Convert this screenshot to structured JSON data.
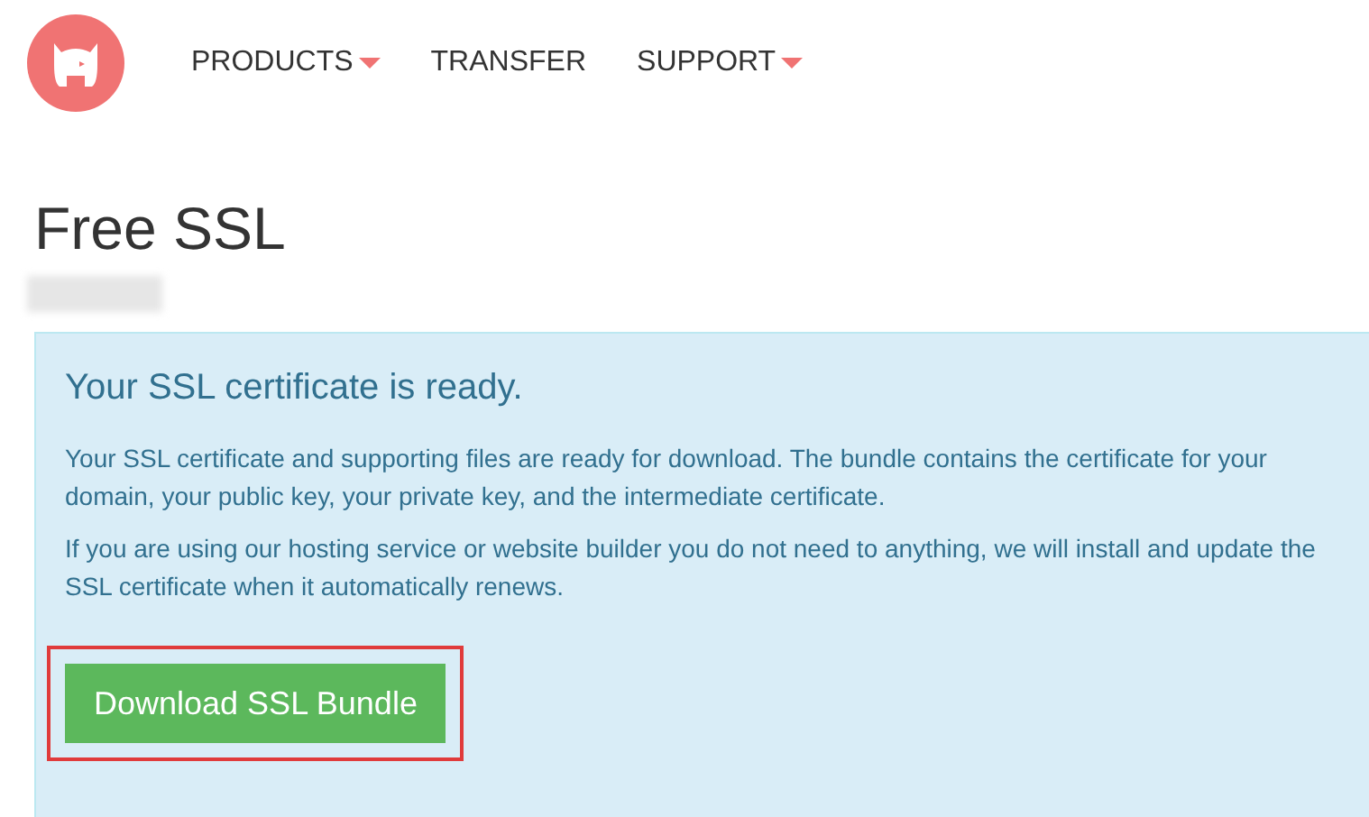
{
  "nav": {
    "items": [
      {
        "label": "PRODUCTS",
        "has_dropdown": true
      },
      {
        "label": "TRANSFER",
        "has_dropdown": false
      },
      {
        "label": "SUPPORT",
        "has_dropdown": true
      }
    ]
  },
  "page": {
    "title": "Free SSL",
    "subtitle_redacted": true
  },
  "alert": {
    "heading": "Your SSL certificate is ready.",
    "paragraphs": [
      "Your SSL certificate and supporting files are ready for download. The bundle contains the certificate for your domain, your public key, your private key, and the intermediate certificate.",
      "If you are using our hosting service or website builder you do not need to anything, we will install and update the SSL certificate when it automatically renews."
    ],
    "button": {
      "label": "Download SSL Bundle",
      "highlighted": true
    }
  }
}
